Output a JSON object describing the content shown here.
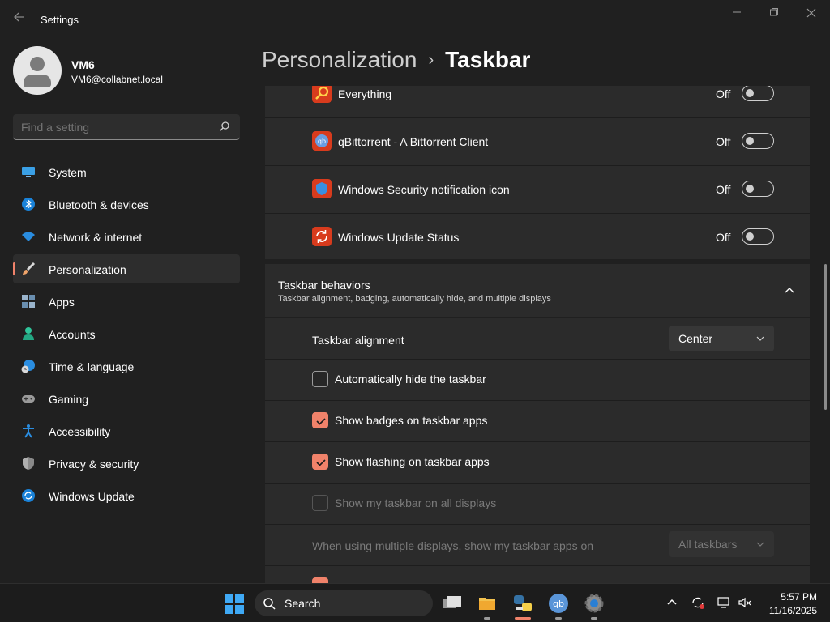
{
  "window": {
    "title": "Settings"
  },
  "profile": {
    "name": "VM6",
    "email": "VM6@collabnet.local"
  },
  "search": {
    "placeholder": "Find a setting"
  },
  "nav": {
    "items": [
      {
        "label": "System",
        "icon": "monitor-icon"
      },
      {
        "label": "Bluetooth & devices",
        "icon": "bluetooth-icon"
      },
      {
        "label": "Network & internet",
        "icon": "wifi-icon"
      },
      {
        "label": "Personalization",
        "icon": "paintbrush-icon",
        "active": true
      },
      {
        "label": "Apps",
        "icon": "apps-icon"
      },
      {
        "label": "Accounts",
        "icon": "person-icon"
      },
      {
        "label": "Time & language",
        "icon": "globe-clock-icon"
      },
      {
        "label": "Gaming",
        "icon": "gamepad-icon"
      },
      {
        "label": "Accessibility",
        "icon": "accessibility-icon"
      },
      {
        "label": "Privacy & security",
        "icon": "shield-icon"
      },
      {
        "label": "Windows Update",
        "icon": "update-icon"
      }
    ]
  },
  "breadcrumb": {
    "parent": "Personalization",
    "separator": "›",
    "current": "Taskbar"
  },
  "tray_apps": [
    {
      "label": "Everything",
      "state": "Off",
      "icon": "magnifier-app-icon",
      "color": "#d83b1d"
    },
    {
      "label": "qBittorrent - A Bittorrent Client",
      "state": "Off",
      "icon": "qbittorrent-icon",
      "color": "#d83b1d"
    },
    {
      "label": "Windows Security notification icon",
      "state": "Off",
      "icon": "shield-app-icon",
      "color": "#d83b1d"
    },
    {
      "label": "Windows Update Status",
      "state": "Off",
      "icon": "update-app-icon",
      "color": "#d83b1d"
    }
  ],
  "behaviors": {
    "title": "Taskbar behaviors",
    "subtitle": "Taskbar alignment, badging, automatically hide, and multiple displays",
    "alignment": {
      "label": "Taskbar alignment",
      "value": "Center"
    },
    "options": [
      {
        "label": "Automatically hide the taskbar",
        "checked": false,
        "disabled": false
      },
      {
        "label": "Show badges on taskbar apps",
        "checked": true,
        "disabled": false
      },
      {
        "label": "Show flashing on taskbar apps",
        "checked": true,
        "disabled": false
      },
      {
        "label": "Show my taskbar on all displays",
        "checked": false,
        "disabled": true
      }
    ],
    "multi_display": {
      "label": "When using multiple displays, show my taskbar apps on",
      "value": "All taskbars",
      "disabled": true
    }
  },
  "taskbar": {
    "search_label": "Search",
    "time": "5:57 PM",
    "date": "11/16/2025"
  },
  "colors": {
    "accent": "#f0826a",
    "background": "#202020",
    "card": "#2b2b2b"
  }
}
